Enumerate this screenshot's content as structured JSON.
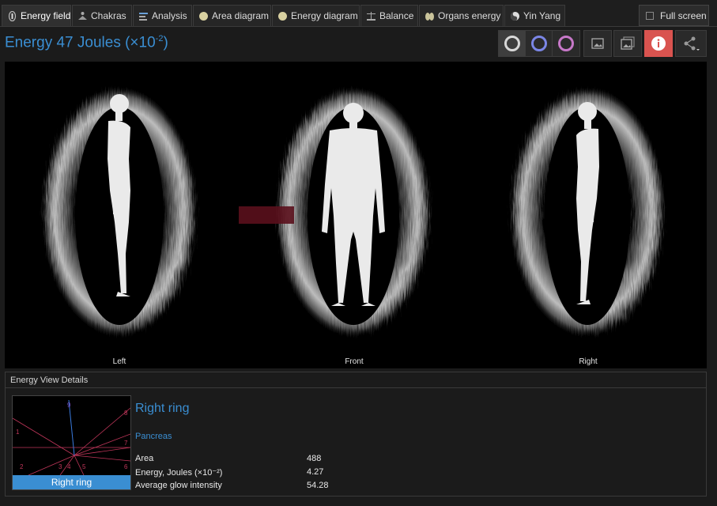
{
  "tabs": [
    {
      "label": "Energy field",
      "icon": "energy-field-icon",
      "active": true
    },
    {
      "label": "Chakras",
      "icon": "chakras-icon",
      "active": false
    },
    {
      "label": "Analysis",
      "icon": "analysis-icon",
      "active": false
    },
    {
      "label": "Area diagram",
      "icon": "area-diagram-icon",
      "active": false
    },
    {
      "label": "Energy diagram",
      "icon": "energy-diagram-icon",
      "active": false
    },
    {
      "label": "Balance",
      "icon": "balance-icon",
      "active": false
    },
    {
      "label": "Organs energy",
      "icon": "organs-icon",
      "active": false
    },
    {
      "label": "Yin Yang",
      "icon": "yin-yang-icon",
      "active": false
    }
  ],
  "fullscreen_label": "Full screen",
  "header": {
    "title_prefix": "Energy 47 Joules (×10",
    "title_exponent": "-2",
    "title_suffix": ")"
  },
  "toolbar": {
    "ring_colors": [
      "#d8d8d8",
      "#7b86e6",
      "#c778c8"
    ],
    "info_color": "#d9534f"
  },
  "views": {
    "left": "Left",
    "front": "Front",
    "right": "Right"
  },
  "details": {
    "panel_title": "Energy View Details",
    "ring_button": "Right ring",
    "ring_name": "Right ring",
    "organ": "Pancreas",
    "rows": [
      {
        "label": "Area",
        "value": "488"
      },
      {
        "label": "Energy, Joules (×10⁻²)",
        "value": "4.27"
      },
      {
        "label": "Average glow intensity",
        "value": "54.28"
      }
    ],
    "sector_numbers": [
      "1",
      "2",
      "3",
      "4",
      "5",
      "6",
      "7",
      "8",
      "9"
    ]
  },
  "colors": {
    "accent": "#3a8ed2",
    "background": "#1b1b1b"
  }
}
